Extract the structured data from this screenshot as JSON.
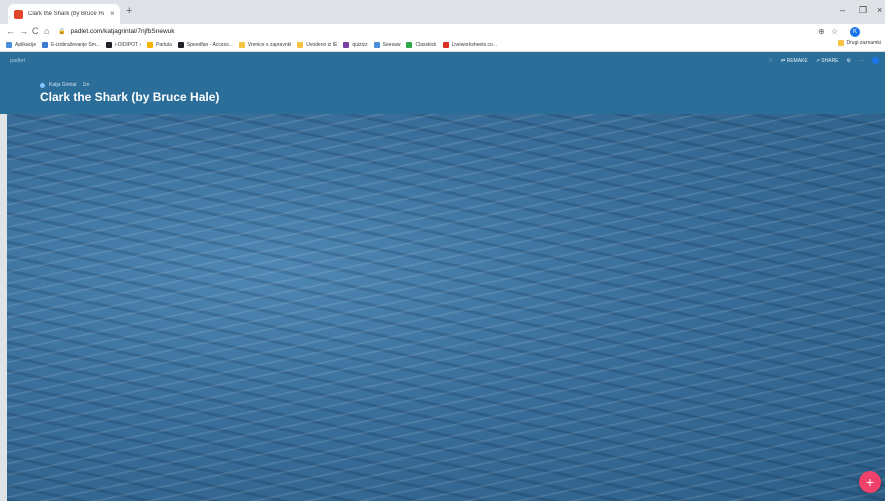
{
  "browser": {
    "tab_title": "Clark the Shark (by Bruce Hale)",
    "tab_close": "×",
    "new_tab": "+",
    "win_minimize": "–",
    "win_maximize": "❐",
    "win_close": "×",
    "nav_back": "←",
    "nav_forward": "→",
    "nav_reload": "C",
    "nav_home": "⌂",
    "url": "padlet.com/katjagrintal/7njfbSnewuk",
    "lock_icon": "🔒",
    "profile_initial": "K",
    "bookmarks": [
      {
        "label": "Aplikacije",
        "color": "#4a90d9"
      },
      {
        "label": "E-izobraževanje Sm...",
        "color": "#3a7bd5"
      },
      {
        "label": "i-DIDIPOT ›",
        "color": "#202124"
      },
      {
        "label": "Partula",
        "color": "#f4b400"
      },
      {
        "label": "Speedfan - Access...",
        "color": "#202124"
      },
      {
        "label": "Vrenice s zapravnki",
        "color": "#f6c343"
      },
      {
        "label": "Uvodeno iz IE",
        "color": "#f6c343"
      },
      {
        "label": "quizizz",
        "color": "#7b3fa0"
      },
      {
        "label": "Seesaw",
        "color": "#4a90d9"
      },
      {
        "label": "Classkick",
        "color": "#2ea64a"
      },
      {
        "label": "Liveworksheets.co...",
        "color": "#d93025"
      }
    ],
    "bookmarks_other": "Drugi zaznamki"
  },
  "padlet": {
    "brand": "padlet",
    "actions": {
      "heart": "♡",
      "remake": "⇄ REMAKE",
      "share": "↗ SHARE",
      "settings": "⚙",
      "more": "⋯"
    },
    "author": "Katja Grintal",
    "author_time": "1m",
    "title": "Clark the Shark (by Bruce Hale)",
    "fab": "+"
  },
  "colors": {
    "header": "#2b6e99",
    "fab": "#f0416b"
  }
}
